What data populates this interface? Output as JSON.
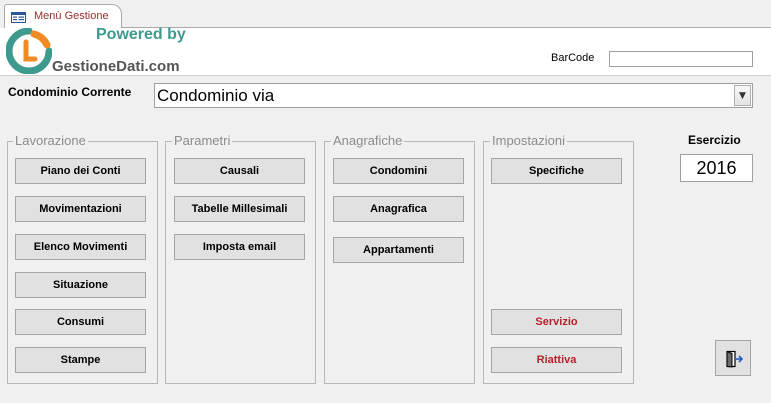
{
  "tab": {
    "label": "Menù Gestione",
    "icon": "form-icon"
  },
  "header": {
    "powered_by": "Powered by",
    "brand": "GestioneDati.com",
    "barcode_label": "BarCode",
    "barcode_value": ""
  },
  "condominio": {
    "label": "Condominio Corrente",
    "value": "Condominio via"
  },
  "groups": {
    "lavorazione": {
      "title": "Lavorazione",
      "buttons": [
        "Piano dei Conti",
        "Movimentazioni",
        "Elenco Movimenti",
        "Situazione",
        "Consumi",
        "Stampe"
      ]
    },
    "parametri": {
      "title": "Parametri",
      "buttons": [
        "Causali",
        "Tabelle Millesimali",
        "Imposta email"
      ]
    },
    "anagrafiche": {
      "title": "Anagrafiche",
      "buttons": [
        "Condomini",
        "Anagrafica",
        "Appartamenti"
      ]
    },
    "impostazioni": {
      "title": "Impostazioni",
      "buttons": [
        "Specifiche",
        "Servizio",
        "Riattiva"
      ]
    }
  },
  "esercizio": {
    "label": "Esercizio",
    "value": "2016"
  },
  "colors": {
    "accent_red": "#b5232b",
    "logo_teal": "#3e9a8e",
    "logo_orange": "#f08a24",
    "tab_label": "#9b2c2c"
  },
  "exit": {
    "icon": "exit-door-icon"
  }
}
